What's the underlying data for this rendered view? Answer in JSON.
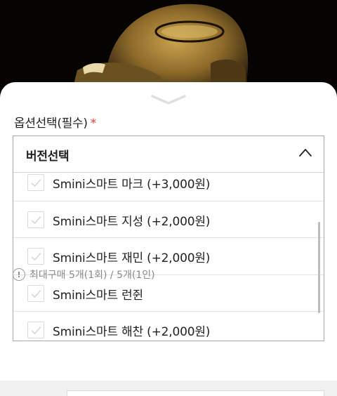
{
  "photo": {
    "description_icon": "product-image"
  },
  "sheet": {
    "handle_icon": "chevron-down-icon",
    "section_label": "옵션선택(필수)",
    "required_mark": "*",
    "select": {
      "title": "버전선택",
      "toggle_icon": "chevron-up-icon",
      "options": [
        {
          "label": "Smini스마트 마크 (+3,000원)",
          "checked": false
        },
        {
          "label": "Smini스마트 지성 (+2,000원)",
          "checked": false
        },
        {
          "label": "Smini스마트 재민 (+2,000원)",
          "checked": false
        },
        {
          "label": "Smini스마트 런쥔",
          "checked": false
        },
        {
          "label": "Smini스마트 해찬 (+2,000원)",
          "checked": false
        }
      ]
    },
    "purchase_limit": {
      "icon": "info-icon",
      "icon_glyph": "!",
      "text": "최대구매 5개(1회) / 5개(1인)"
    }
  },
  "colors": {
    "required": "#e53935",
    "border": "#a9a9a9",
    "muted": "#8a8a8a"
  }
}
